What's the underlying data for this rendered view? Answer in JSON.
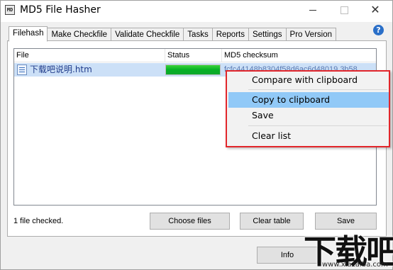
{
  "window": {
    "title": "MD5 File Hasher",
    "icon_label": "MD"
  },
  "tabs": [
    {
      "label": "Filehash",
      "active": true
    },
    {
      "label": "Make Checkfile",
      "active": false
    },
    {
      "label": "Validate Checkfile",
      "active": false
    },
    {
      "label": "Tasks",
      "active": false
    },
    {
      "label": "Reports",
      "active": false
    },
    {
      "label": "Settings",
      "active": false
    },
    {
      "label": "Pro Version",
      "active": false
    }
  ],
  "help_label": "?",
  "list": {
    "columns": [
      "File",
      "Status",
      "MD5 checksum"
    ],
    "rows": [
      {
        "file": "下载吧说明.htm",
        "progress": 1.0,
        "md5": "fcfc44148b8304f58d6ac6d48019 3b58"
      }
    ]
  },
  "status_text": "1 file checked.",
  "buttons": {
    "choose_files": "Choose files",
    "clear_table": "Clear table",
    "save": "Save",
    "info": "Info"
  },
  "context_menu": {
    "items": [
      {
        "label": "Compare with clipboard",
        "highlighted": false
      },
      {
        "label": "Copy to clipboard",
        "highlighted": true
      },
      {
        "label": "Save",
        "highlighted": false
      },
      {
        "label": "Clear list",
        "highlighted": false
      }
    ],
    "border_color": "#e2262b"
  },
  "watermark": {
    "logo": "下载吧",
    "url": "www.xiazaiba.com"
  },
  "colors": {
    "progress": "#06b025",
    "selection": "#cce0f7",
    "menu_highlight": "#91c9f7"
  }
}
